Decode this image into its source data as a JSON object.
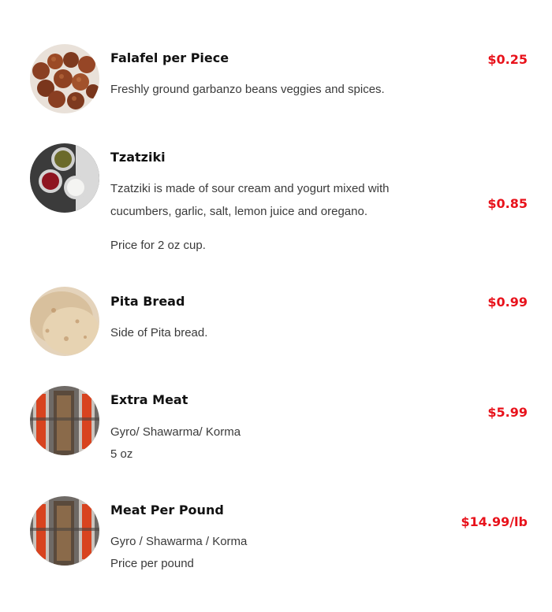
{
  "menu": {
    "items": [
      {
        "name": "Falafel per Piece",
        "price": "$0.25",
        "description": [
          "Freshly ground garbanzo beans veggies and spices."
        ],
        "image_icon": "falafel-photo"
      },
      {
        "name": "Tzatziki",
        "price": "$0.85",
        "description": [
          "Tzatziki is made of sour cream and yogurt mixed with",
          "cucumbers, garlic, salt, lemon juice and oregano.",
          "Price for 2 oz cup."
        ],
        "image_icon": "sauces-photo"
      },
      {
        "name": "Pita Bread",
        "price": "$0.99",
        "description": [
          "Side of Pita bread."
        ],
        "image_icon": "pita-bread-photo"
      },
      {
        "name": "Extra Meat",
        "price": "$5.99",
        "description": [
          "Gyro/ Shawarma/ Korma",
          "5 oz"
        ],
        "image_icon": "meat-spit-photo"
      },
      {
        "name": "Meat Per Pound",
        "price": "$14.99/lb",
        "description": [
          "Gyro / Shawarma / Korma",
          "Price per pound"
        ],
        "image_icon": "meat-spit-photo"
      }
    ]
  },
  "colors": {
    "price": "#e8121b",
    "name": "#111111",
    "description": "#3a3a3a",
    "background": "#ffffff"
  }
}
